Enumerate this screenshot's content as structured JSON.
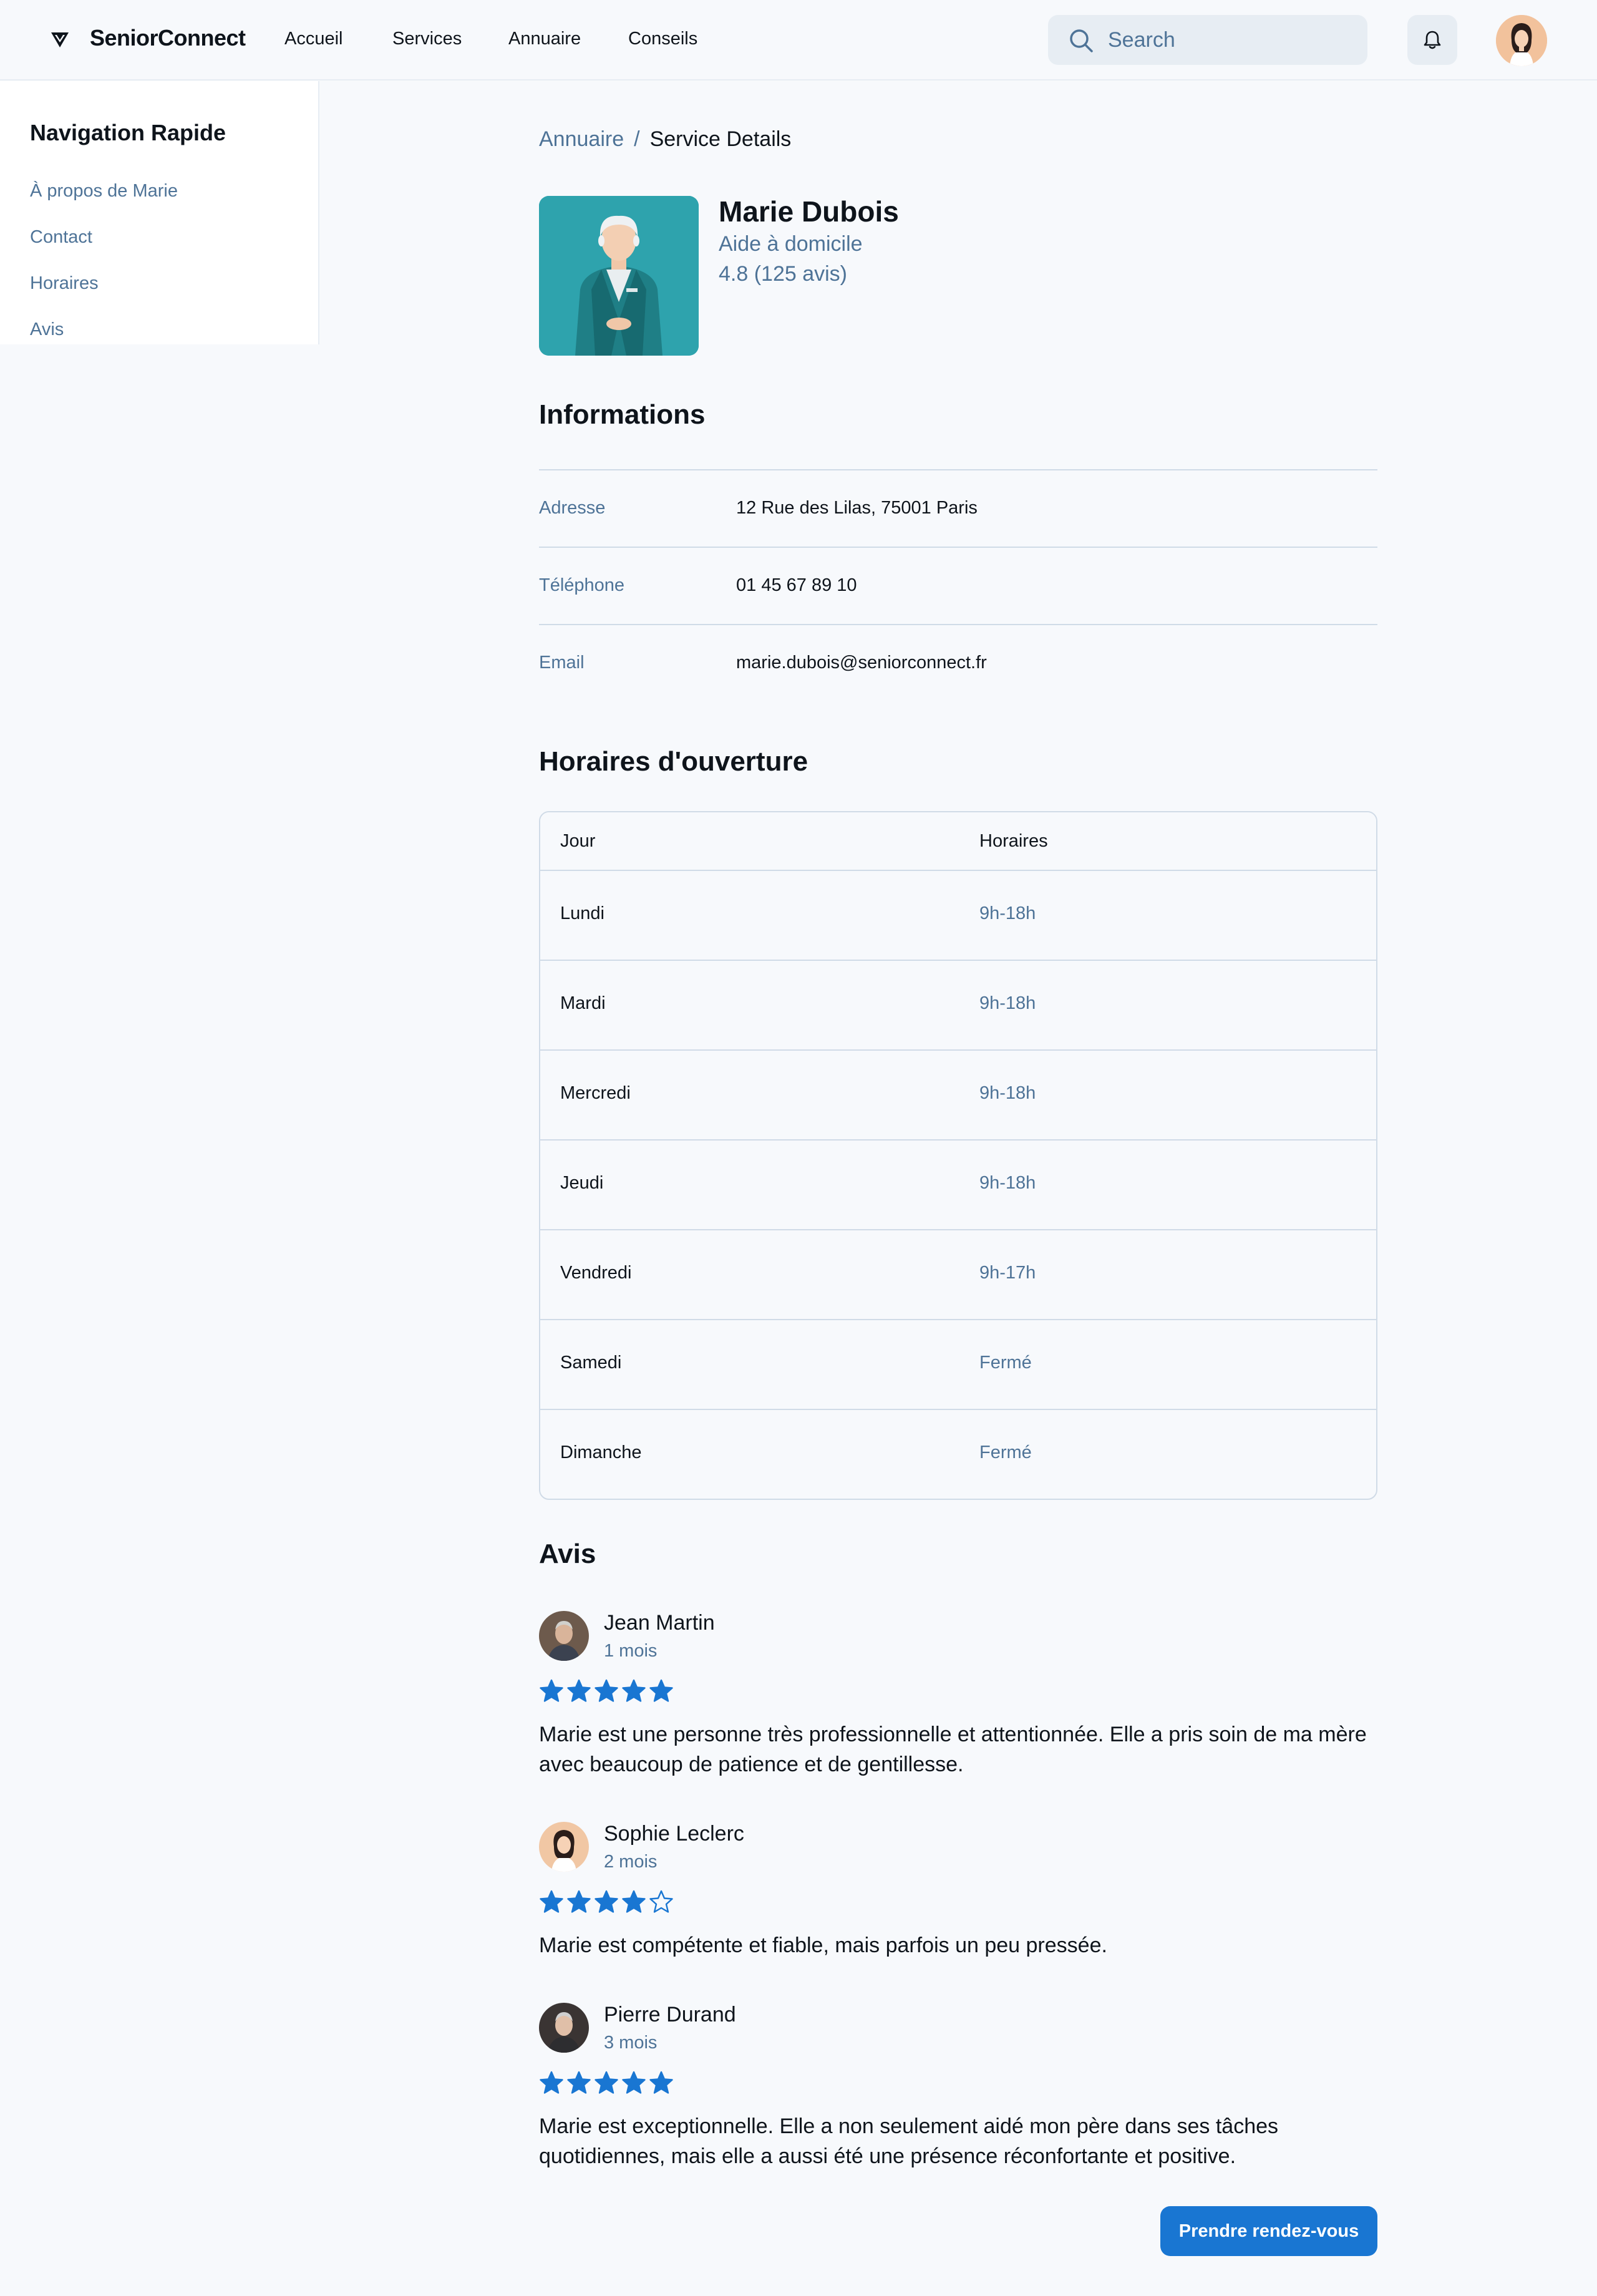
{
  "header": {
    "brand": "SeniorConnect",
    "nav": [
      "Accueil",
      "Services",
      "Annuaire",
      "Conseils"
    ],
    "search_placeholder": "Search"
  },
  "sidebar": {
    "title": "Navigation Rapide",
    "items": [
      "À propos de Marie",
      "Contact",
      "Horaires",
      "Avis"
    ]
  },
  "breadcrumb": {
    "parent": "Annuaire",
    "separator": "/",
    "current": "Service Details"
  },
  "profile": {
    "name": "Marie Dubois",
    "role": "Aide à domicile",
    "rating": "4.8 (125 avis)"
  },
  "informations": {
    "title": "Informations",
    "rows": [
      {
        "label": "Adresse",
        "value": "12 Rue des Lilas, 75001 Paris"
      },
      {
        "label": "Téléphone",
        "value": "01 45 67 89 10"
      },
      {
        "label": "Email",
        "value": "marie.dubois@seniorconnect.fr"
      }
    ]
  },
  "hours": {
    "title": "Horaires d'ouverture",
    "headers": [
      "Jour",
      "Horaires"
    ],
    "rows": [
      {
        "day": "Lundi",
        "hours": "9h-18h"
      },
      {
        "day": "Mardi",
        "hours": "9h-18h"
      },
      {
        "day": "Mercredi",
        "hours": "9h-18h"
      },
      {
        "day": "Jeudi",
        "hours": "9h-18h"
      },
      {
        "day": "Vendredi",
        "hours": "9h-17h"
      },
      {
        "day": "Samedi",
        "hours": "Fermé"
      },
      {
        "day": "Dimanche",
        "hours": "Fermé"
      }
    ]
  },
  "reviews": {
    "title": "Avis",
    "items": [
      {
        "name": "Jean Martin",
        "time": "1 mois",
        "rating": 5,
        "text": "Marie est une personne très professionnelle et attentionnée. Elle a pris soin de ma mère avec beaucoup de patience et de gentillesse."
      },
      {
        "name": "Sophie Leclerc",
        "time": "2 mois",
        "rating": 4,
        "text": "Marie est compétente et fiable, mais parfois un peu pressée."
      },
      {
        "name": "Pierre Durand",
        "time": "3 mois",
        "rating": 5,
        "text": "Marie est exceptionnelle. Elle a non seulement aidé mon père dans ses tâches quotidiennes, mais elle a aussi été une présence réconfortante et positive."
      }
    ]
  },
  "cta": {
    "label": "Prendre rendez-vous"
  },
  "colors": {
    "accent": "#1976d2",
    "muted": "#4e7397",
    "border": "#d0dbe7"
  }
}
